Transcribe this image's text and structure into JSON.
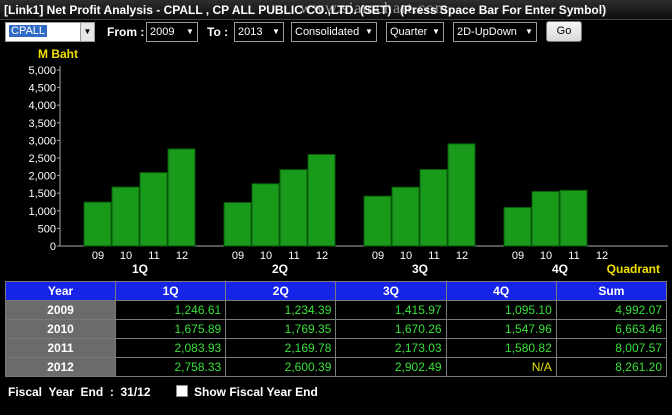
{
  "window": {
    "title": "[Link1] Net Profit Analysis - CPALL , CP ALL PUBLIC CO.,LTD.  (SET)",
    "watermark": "www.siamchart.com",
    "hint": "(Press Space Bar For Enter Symbol)"
  },
  "toolbar": {
    "symbol": "CPALL",
    "from_label": "From :",
    "from_value": "2009",
    "to_label": "To :",
    "to_value": "2013",
    "statement": "Consolidated",
    "period": "Quarter",
    "chart_style": "2D-UpDown",
    "go_label": "Go"
  },
  "colors": {
    "bar": "#1a9a1a",
    "bar_edge": "#0a5a0a",
    "header_bg": "#1524e6",
    "value": "#38e038",
    "unit": "#f0e000"
  },
  "chart_data": {
    "type": "bar",
    "unit_label": "M Baht",
    "xlabel": "Quadrant",
    "ylim": [
      0,
      5000
    ],
    "yticks": [
      "0",
      "500",
      "1,000",
      "1,500",
      "2,000",
      "2,500",
      "3,000",
      "3,500",
      "4,000",
      "4,500",
      "5,000"
    ],
    "groups": [
      {
        "label": "1Q",
        "bars": [
          {
            "year": "09",
            "value": 1246.61
          },
          {
            "year": "10",
            "value": 1675.89
          },
          {
            "year": "11",
            "value": 2083.93
          },
          {
            "year": "12",
            "value": 2758.33
          }
        ]
      },
      {
        "label": "2Q",
        "bars": [
          {
            "year": "09",
            "value": 1234.39
          },
          {
            "year": "10",
            "value": 1769.35
          },
          {
            "year": "11",
            "value": 2169.78
          },
          {
            "year": "12",
            "value": 2600.39
          }
        ]
      },
      {
        "label": "3Q",
        "bars": [
          {
            "year": "09",
            "value": 1415.97
          },
          {
            "year": "10",
            "value": 1670.26
          },
          {
            "year": "11",
            "value": 2173.03
          },
          {
            "year": "12",
            "value": 2902.49
          }
        ]
      },
      {
        "label": "4Q",
        "bars": [
          {
            "year": "09",
            "value": 1095.1
          },
          {
            "year": "10",
            "value": 1547.96
          },
          {
            "year": "11",
            "value": 1580.82
          },
          {
            "year": "12",
            "value": null
          }
        ]
      }
    ]
  },
  "table": {
    "headers": [
      "Year",
      "1Q",
      "2Q",
      "3Q",
      "4Q",
      "Sum"
    ],
    "rows": [
      [
        "2009",
        "1,246.61",
        "1,234.39",
        "1,415.97",
        "1,095.10",
        "4,992.07"
      ],
      [
        "2010",
        "1,675.89",
        "1,769.35",
        "1,670.26",
        "1,547.96",
        "6,663.46"
      ],
      [
        "2011",
        "2,083.93",
        "2,169.78",
        "2,173.03",
        "1,580.82",
        "8,007.57"
      ],
      [
        "2012",
        "2,758.33",
        "2,600.39",
        "2,902.49",
        "N/A",
        "8,261.20"
      ]
    ]
  },
  "footer": {
    "fiscal_year_end": "Fiscal  Year  End  :  31/12",
    "show_fiscal_label": "Show Fiscal Year End",
    "show_fiscal_checked": false
  }
}
